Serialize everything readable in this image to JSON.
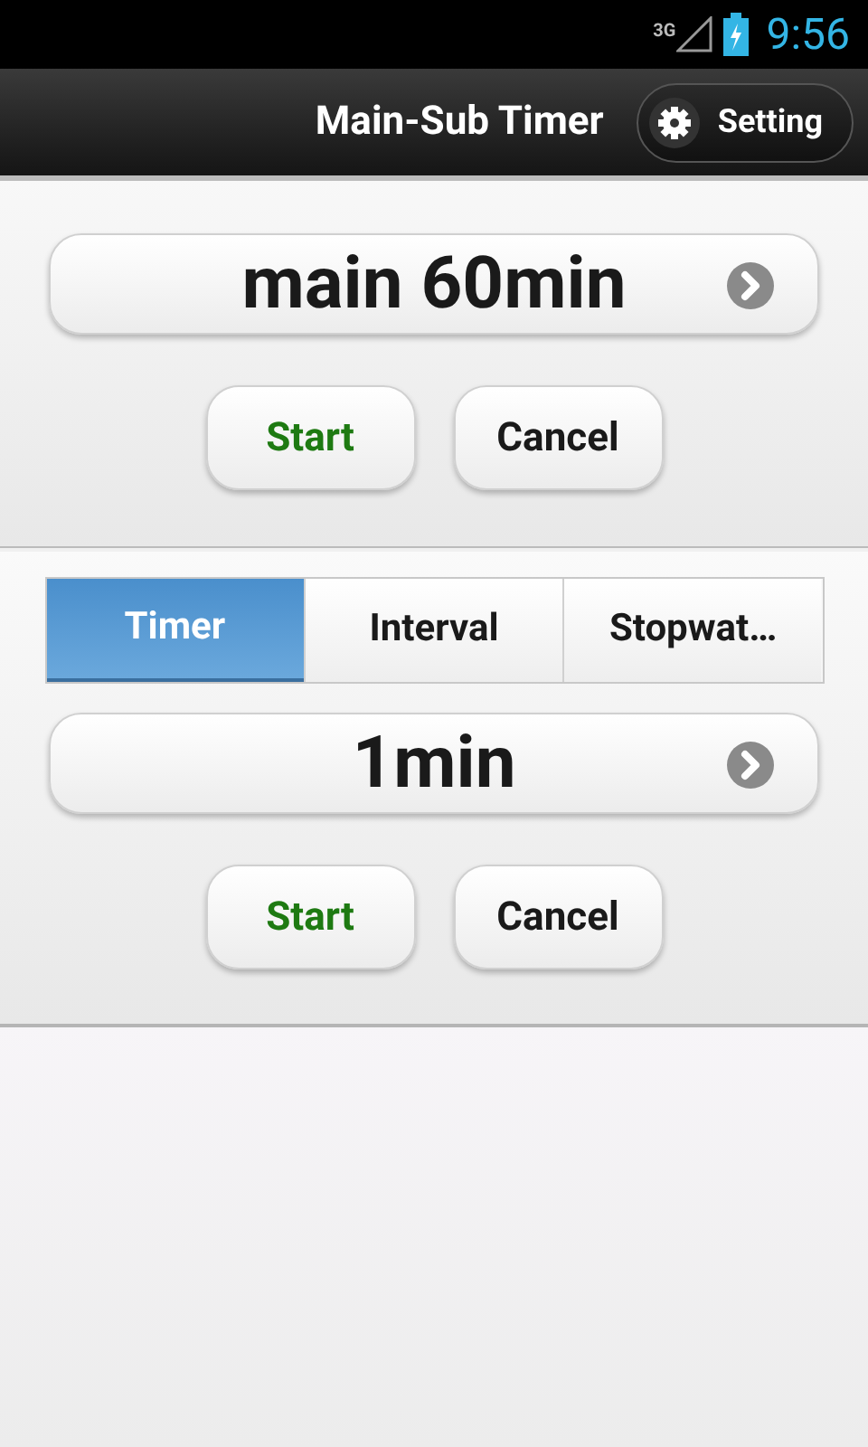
{
  "status_bar": {
    "network": "3G",
    "time": "9:56"
  },
  "header": {
    "title": "Main-Sub Timer",
    "setting_button": "Setting"
  },
  "main_timer": {
    "value": "main 60min",
    "start": "Start",
    "cancel": "Cancel"
  },
  "sub_timer": {
    "tabs": [
      {
        "label": "Timer",
        "selected": true
      },
      {
        "label": "Interval",
        "selected": false
      },
      {
        "label": "Stopwat…",
        "selected": false
      }
    ],
    "value": "1min",
    "start": "Start",
    "cancel": "Cancel"
  }
}
